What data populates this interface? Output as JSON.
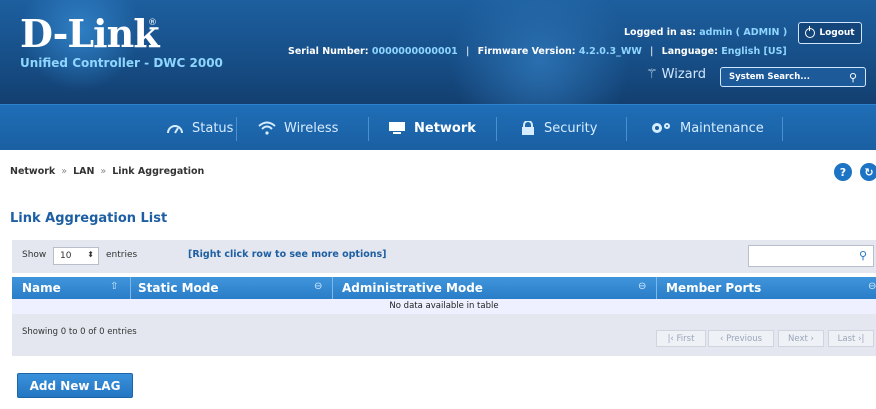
{
  "header": {
    "logo_title": "D-Link",
    "logo_reg": "®",
    "logo_subtitle": "Unified Controller - DWC 2000",
    "serial_label": "Serial Number:",
    "serial_value": "0000000000001",
    "firmware_label": "Firmware Version:",
    "firmware_value": "4.2.0.3_WW",
    "language_label": "Language:",
    "language_value": "English [US]",
    "logged_in_label": "Logged in as:",
    "logged_in_value": "admin ( ADMIN )",
    "logout_label": "Logout",
    "wizard_label": "Wizard",
    "search_placeholder": "System Search..."
  },
  "nav": {
    "items": [
      {
        "label": "Status",
        "icon": "dashboard-icon"
      },
      {
        "label": "Wireless",
        "icon": "wifi-icon"
      },
      {
        "label": "Network",
        "icon": "network-icon"
      },
      {
        "label": "Security",
        "icon": "lock-icon"
      },
      {
        "label": "Maintenance",
        "icon": "gears-icon"
      }
    ],
    "active": "Network"
  },
  "breadcrumb": {
    "items": [
      "Network",
      "LAN",
      "Link Aggregation"
    ],
    "separator": "»"
  },
  "page_title": "Link Aggregation List",
  "toolbar": {
    "show_label": "Show",
    "show_value": "10",
    "entries_label": "entries",
    "hint": "[Right click row to see more options]"
  },
  "table": {
    "columns": [
      "Name",
      "Static Mode",
      "Administrative Mode",
      "Member Ports"
    ],
    "empty_message": "No data available in table",
    "info": "Showing 0 to 0 of 0 entries",
    "pagination": [
      "First",
      "Previous",
      "Next",
      "Last"
    ]
  },
  "add_button_label": "Add New LAG",
  "colors": {
    "header_blue": "#174f88",
    "nav_blue": "#1a5fa2",
    "accent_cyan": "#8ed6ff",
    "table_header": "#2a7dc7"
  }
}
